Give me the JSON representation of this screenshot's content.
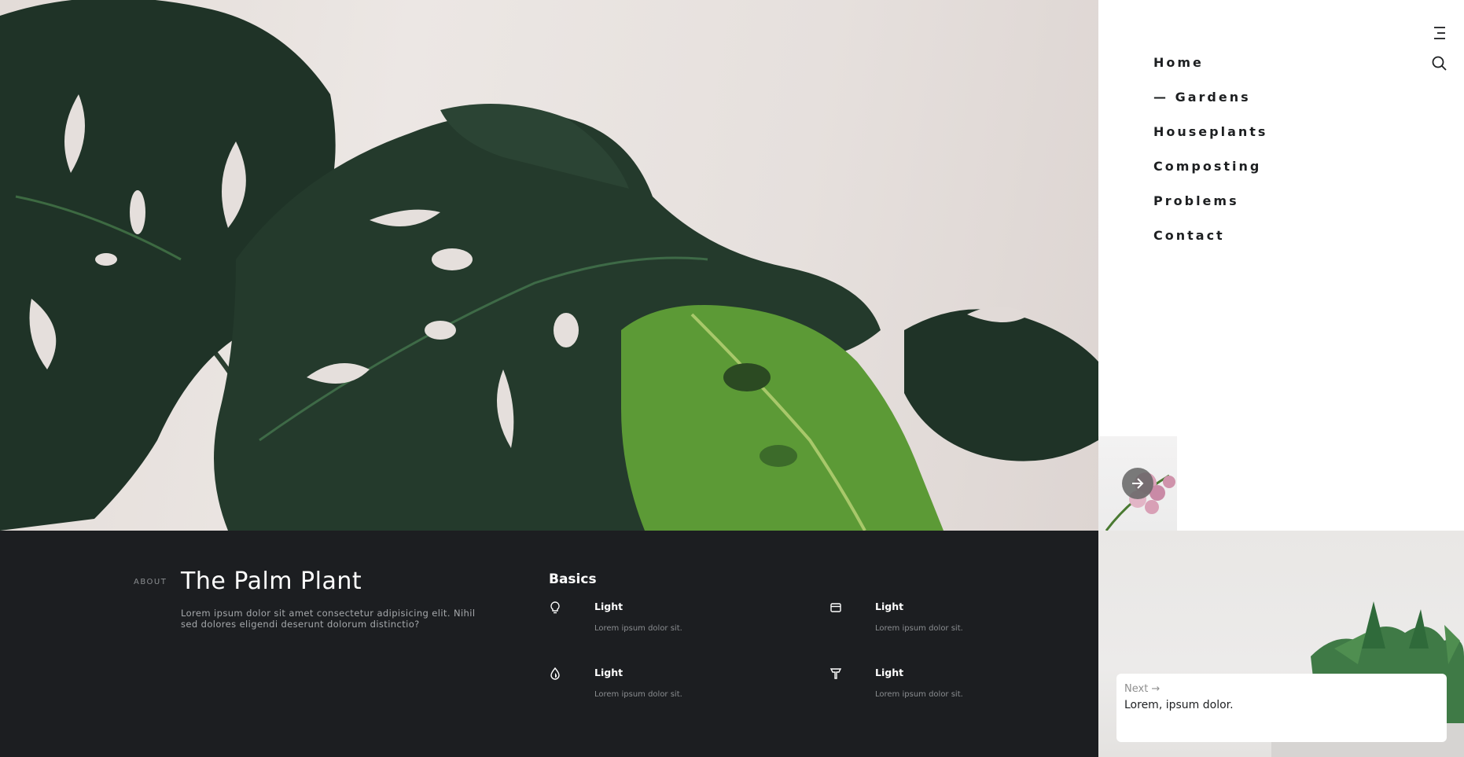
{
  "nav": {
    "items": [
      {
        "label": "Home"
      },
      {
        "label": "— Gardens"
      },
      {
        "label": "Houseplants"
      },
      {
        "label": "Composting"
      },
      {
        "label": "Problems"
      },
      {
        "label": "Contact"
      }
    ],
    "menu_icon": "menu-lines-icon",
    "search_icon": "search-icon"
  },
  "hero": {
    "image": "monstera-leaves-photo"
  },
  "thumbnail": {
    "image": "pink-flower-photo",
    "arrow_icon": "arrow-right-icon"
  },
  "about": {
    "kicker": "ABOUT",
    "title": "The Palm Plant",
    "description": "Lorem ipsum dolor sit amet consectetur adipisicing elit. Nihil sed dolores eligendi deserunt dolorum distinctio?"
  },
  "basics": {
    "title": "Basics",
    "items": [
      {
        "icon": "lightbulb-icon",
        "label": "Light",
        "text": "Lorem ipsum dolor sit."
      },
      {
        "icon": "calendar-icon",
        "label": "Light",
        "text": "Lorem ipsum dolor sit."
      },
      {
        "icon": "water-drop-icon",
        "label": "Light",
        "text": "Lorem ipsum dolor sit."
      },
      {
        "icon": "trowel-icon",
        "label": "Light",
        "text": "Lorem ipsum dolor sit."
      }
    ]
  },
  "next": {
    "label": "Next →",
    "title": "Lorem, ipsum dolor.",
    "image": "succulent-photo"
  },
  "colors": {
    "dark_bg": "#1c1e21",
    "text_dark": "#1d1f21",
    "muted": "#8a8d90",
    "leaf_dark": "#1f3327",
    "leaf_bright": "#5c9a36"
  }
}
